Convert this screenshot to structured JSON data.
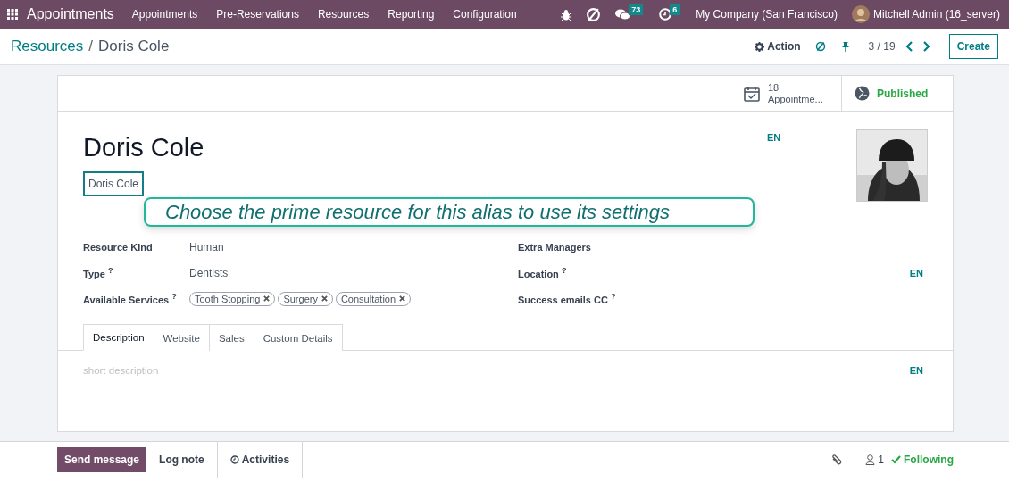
{
  "navbar": {
    "app_name": "Appointments",
    "menu": [
      "Appointments",
      "Pre-Reservations",
      "Resources",
      "Reporting",
      "Configuration"
    ],
    "messages_count": "73",
    "activities_count": "6",
    "company": "My Company (San Francisco)",
    "user": "Mitchell Admin (16_server)"
  },
  "breadcrumb": {
    "parent": "Resources",
    "separator": "/",
    "current": "Doris Cole"
  },
  "control_panel": {
    "action": "Action",
    "pager": "3 / 19",
    "create": "Create"
  },
  "smart_buttons": [
    {
      "kind": "count",
      "value": "18",
      "label": "Appointme..."
    },
    {
      "kind": "status",
      "label": "Published"
    }
  ],
  "form": {
    "title": "Doris Cole",
    "title_lang": "EN",
    "alias": "Doris Cole",
    "tooltip": "Choose the prime resource for this alias to use its settings",
    "left_fields": [
      {
        "label": "Resource Kind",
        "value": "Human"
      },
      {
        "label": "Type $^{?}$",
        "value": "Dentists"
      },
      {
        "label": "Available Services $^{?}$",
        "tags": [
          "Tooth Stopping",
          "Surgery",
          "Consultation"
        ]
      }
    ],
    "right_fields": [
      {
        "label": "Extra Managers"
      },
      {
        "label": "Location $^{?}$",
        "lang": "EN"
      },
      {
        "label": "Success emails CC $^{?}$"
      }
    ]
  },
  "notebook": {
    "tabs": [
      {
        "label": "Description",
        "selected": true
      },
      {
        "label": "Website",
        "selected": false
      },
      {
        "label": "Sales",
        "selected": false
      },
      {
        "label": "Custom Details",
        "selected": false
      }
    ],
    "placeholder": "short description",
    "lang": "EN"
  },
  "chatter": {
    "send": "Send message",
    "log": "Log note",
    "activities": "Activities",
    "followers": "1",
    "following": "Following"
  }
}
